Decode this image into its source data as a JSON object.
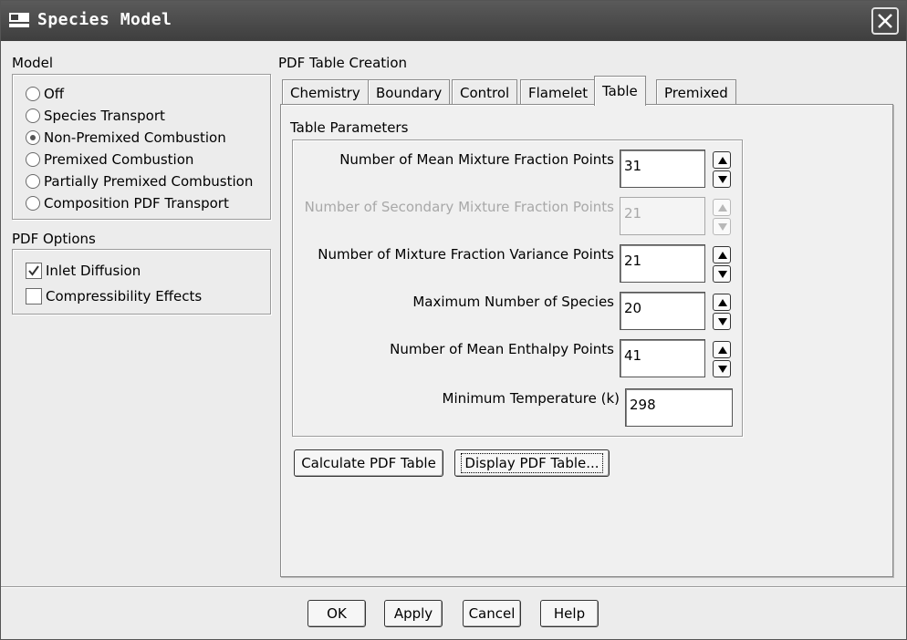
{
  "window": {
    "title": "Species Model"
  },
  "model": {
    "label": "Model",
    "options": [
      {
        "label": "Off",
        "checked": false
      },
      {
        "label": "Species Transport",
        "checked": false
      },
      {
        "label": "Non-Premixed Combustion",
        "checked": true
      },
      {
        "label": "Premixed Combustion",
        "checked": false
      },
      {
        "label": "Partially Premixed Combustion",
        "checked": false
      },
      {
        "label": "Composition PDF Transport",
        "checked": false
      }
    ]
  },
  "pdf_options": {
    "label": "PDF Options",
    "items": [
      {
        "label": "Inlet Diffusion",
        "checked": true
      },
      {
        "label": "Compressibility Effects",
        "checked": false
      }
    ]
  },
  "pdf_table": {
    "label": "PDF Table Creation",
    "tabs": [
      {
        "label": "Chemistry"
      },
      {
        "label": "Boundary"
      },
      {
        "label": "Control"
      },
      {
        "label": "Flamelet"
      },
      {
        "label": "Table",
        "active": true
      },
      {
        "label": "Premixed"
      }
    ],
    "params_label": "Table Parameters",
    "params": [
      {
        "label": "Number of Mean Mixture Fraction Points",
        "value": "31",
        "enabled": true
      },
      {
        "label": "Number of Secondary Mixture Fraction Points",
        "value": "21",
        "enabled": false
      },
      {
        "label": "Number of Mixture Fraction Variance Points",
        "value": "21",
        "enabled": true
      },
      {
        "label": "Maximum Number of Species",
        "value": "20",
        "enabled": true
      },
      {
        "label": "Number of Mean Enthalpy Points",
        "value": "41",
        "enabled": true
      },
      {
        "label": "Minimum Temperature (k)",
        "value": "298",
        "enabled": true
      }
    ],
    "calculate_label": "Calculate PDF Table",
    "display_label": "Display PDF Table..."
  },
  "footer": {
    "ok": "OK",
    "apply": "Apply",
    "cancel": "Cancel",
    "help": "Help"
  },
  "icons": {
    "window": "window-icon",
    "close": "close-icon",
    "spin_up": "arrow-up-icon",
    "spin_down": "arrow-down-icon",
    "check": "check-icon"
  }
}
